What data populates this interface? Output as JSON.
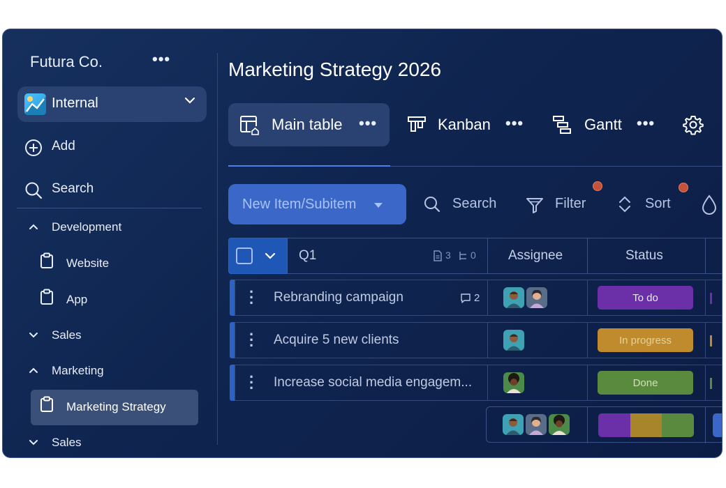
{
  "sidebar": {
    "org_name": "Futura Co.",
    "workspace": "Internal",
    "add_label": "Add",
    "search_label": "Search",
    "tree": [
      {
        "label": "Development",
        "expanded": true
      },
      {
        "label": "Website"
      },
      {
        "label": "App"
      },
      {
        "label": "Sales",
        "expanded": false
      },
      {
        "label": "Marketing",
        "expanded": true
      },
      {
        "label": "Marketing Strategy",
        "selected": true
      },
      {
        "label": "Sales",
        "expanded": false
      }
    ]
  },
  "board": {
    "title": "Marketing Strategy 2026",
    "tabs": [
      {
        "label": "Main table",
        "active": true
      },
      {
        "label": "Kanban"
      },
      {
        "label": "Gantt"
      }
    ]
  },
  "toolbar": {
    "new_item_label": "New Item/Subitem",
    "search_label": "Search",
    "filter_label": "Filter",
    "sort_label": "Sort"
  },
  "table": {
    "group_name": "Q1",
    "group_docs": "3",
    "group_subitems": "0",
    "columns": [
      "Assignee",
      "Status"
    ],
    "rows": [
      {
        "name": "Rebranding campaign",
        "comments": "2",
        "status": "To do",
        "status_color": "#6b2fa8"
      },
      {
        "name": "Acquire 5 new clients",
        "comments": "",
        "status": "In progress",
        "status_color": "#c08b2c"
      },
      {
        "name": "Increase social media engagem...",
        "comments": "",
        "status": "Done",
        "status_color": "#5a8a3d"
      }
    ],
    "summary_status_colors": [
      "#6b2fa8",
      "#a8852b",
      "#5a8a3d"
    ]
  },
  "colors": {
    "accent": "#3a67c8",
    "row_bar": "#2b63c4",
    "notification": "#c4523a"
  }
}
